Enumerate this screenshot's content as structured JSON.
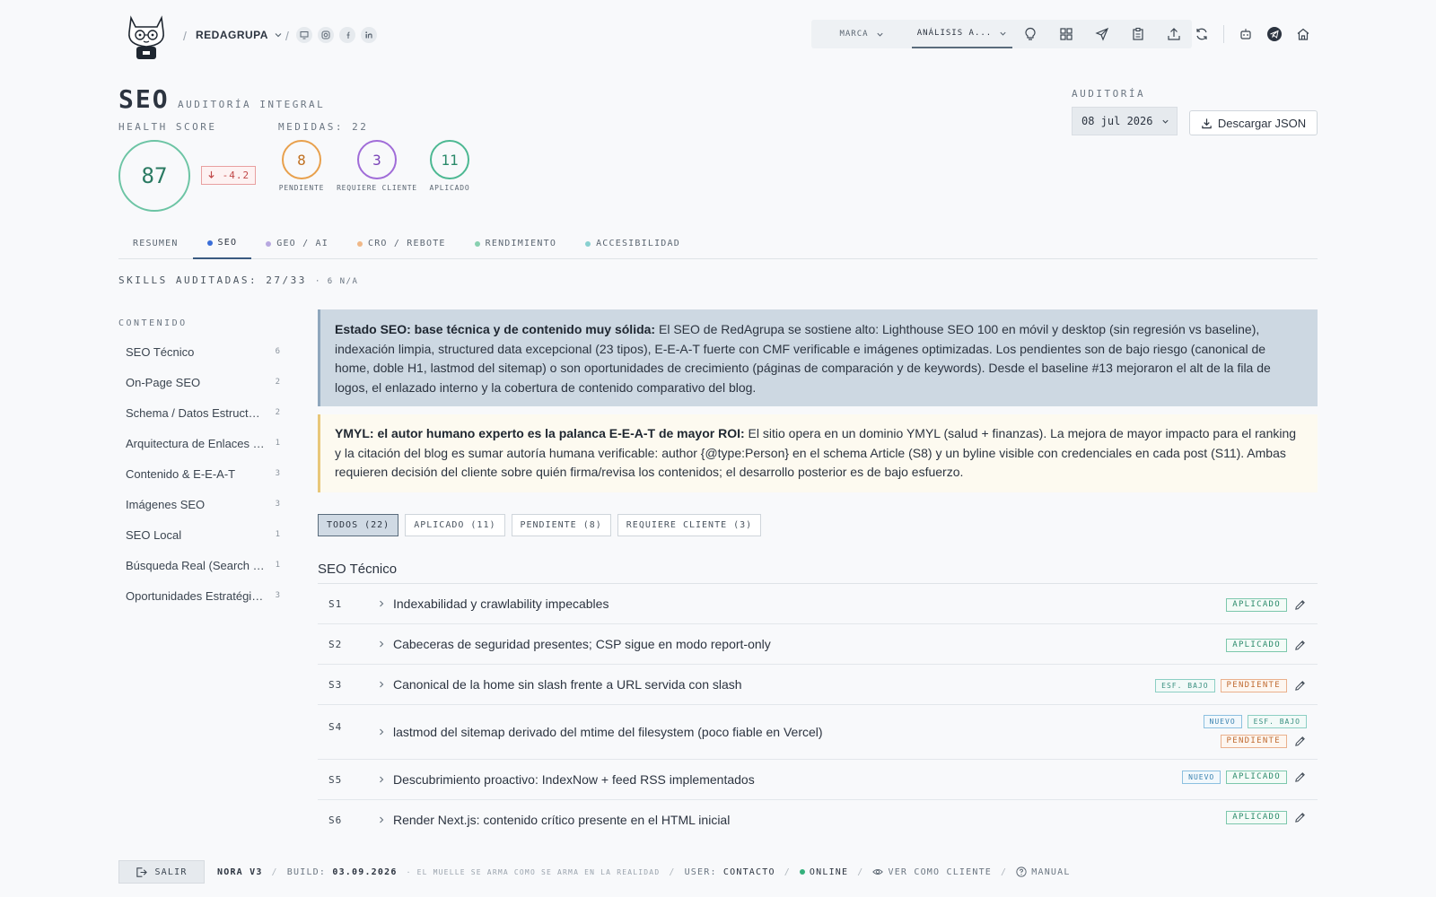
{
  "header": {
    "brand": "REDAGRUPA",
    "selects": [
      {
        "label": "MARCA"
      },
      {
        "label": "ANÁLISIS A..."
      }
    ]
  },
  "page": {
    "title": "SEO",
    "subtitle": "AUDITORÍA INTEGRAL",
    "health_label": "HEALTH SCORE",
    "health_score": "87",
    "health_delta": "-4.2",
    "measures_label": "MEDIDAS: 22",
    "measures": [
      {
        "value": "8",
        "label": "PENDIENTE",
        "color": "#e8a04c"
      },
      {
        "value": "3",
        "label": "REQUIERE CLIENTE",
        "color": "#a06cd8"
      },
      {
        "value": "11",
        "label": "APLICADO",
        "color": "#4cb892"
      }
    ],
    "audit_label": "AUDITORÍA",
    "audit_date": "08 jul 2026",
    "download_label": "Descargar JSON"
  },
  "tabs": [
    {
      "label": "RESUMEN",
      "dot": ""
    },
    {
      "label": "SEO",
      "dot": "#3a6ed8"
    },
    {
      "label": "GEO / AI",
      "dot": "#b8a8e0"
    },
    {
      "label": "CRO / REBOTE",
      "dot": "#f0b888"
    },
    {
      "label": "RENDIMIENTO",
      "dot": "#88d0b0"
    },
    {
      "label": "ACCESIBILIDAD",
      "dot": "#88d0d0"
    }
  ],
  "skills": {
    "text": "SKILLS AUDITADAS: 27/33",
    "na": "· 6 N/A"
  },
  "sidebar": {
    "heading": "CONTENIDO",
    "items": [
      {
        "label": "SEO Técnico",
        "count": "6"
      },
      {
        "label": "On-Page SEO",
        "count": "2"
      },
      {
        "label": "Schema / Datos Estructurados",
        "count": "2"
      },
      {
        "label": "Arquitectura de Enlaces Internos",
        "count": "1"
      },
      {
        "label": "Contenido & E-E-A-T",
        "count": "3"
      },
      {
        "label": "Imágenes SEO",
        "count": "3"
      },
      {
        "label": "SEO Local",
        "count": "1"
      },
      {
        "label": "Búsqueda Real (Search Console)",
        "count": "1"
      },
      {
        "label": "Oportunidades Estratégicas",
        "count": "3"
      }
    ]
  },
  "callouts": {
    "state_bold": "Estado SEO: base técnica y de contenido muy sólida:",
    "state_text": " El SEO de RedAgrupa se sostiene alto: Lighthouse SEO 100 en móvil y desktop (sin regresión vs baseline), indexación limpia, structured data excepcional (23 tipos), E-E-A-T fuerte con CMF verificable e imágenes optimizadas. Los pendientes son de bajo riesgo (canonical de home, doble H1, lastmod del sitemap) o son oportunidades de crecimiento (páginas de comparación y de keywords). Desde el baseline #13 mejoraron el alt de la fila de logos, el enlazado interno y la cobertura de contenido comparativo del blog.",
    "ymyl_bold": "YMYL: el autor humano experto es la palanca E-E-A-T de mayor ROI:",
    "ymyl_text": " El sitio opera en un dominio YMYL (salud + finanzas). La mejora de mayor impacto para el ranking y la citación del blog es sumar autoría humana verificable: author {@type:Person} en el schema Article (S8) y un byline visible con credenciales en cada post (S11). Ambas requieren decisión del cliente sobre quién firma/revisa los contenidos; el desarrollo posterior es de bajo esfuerzo."
  },
  "filters": [
    "TODOS (22)",
    "APLICADO (11)",
    "PENDIENTE (8)",
    "REQUIERE CLIENTE (3)"
  ],
  "section": {
    "title": "SEO Técnico",
    "rows": [
      {
        "id": "S1",
        "title": "Indexabilidad y crawlability impecables",
        "tags": [
          [
            "APLICADO",
            "ap"
          ]
        ]
      },
      {
        "id": "S2",
        "title": "Cabeceras de seguridad presentes; CSP sigue en modo report-only",
        "tags": [
          [
            "APLICADO",
            "ap"
          ]
        ]
      },
      {
        "id": "S3",
        "title": "Canonical de la home sin slash frente a URL servida con slash",
        "tags": [
          [
            "ESF. BAJO",
            "eb"
          ],
          [
            "PENDIENTE",
            "pe"
          ]
        ]
      },
      {
        "id": "S4",
        "title": "lastmod del sitemap derivado del mtime del filesystem (poco fiable en Vercel)",
        "tags": [
          [
            "NUEVO",
            "ne"
          ],
          [
            "ESF. BAJO",
            "eb"
          ],
          [
            "PENDIENTE",
            "pe"
          ]
        ]
      },
      {
        "id": "S5",
        "title": "Descubrimiento proactivo: IndexNow + feed RSS implementados",
        "tags": [
          [
            "NUEVO",
            "ne"
          ],
          [
            "APLICADO",
            "ap"
          ]
        ]
      },
      {
        "id": "S6",
        "title": "Render Next.js: contenido crítico presente en el HTML inicial",
        "tags": [
          [
            "APLICADO",
            "ap"
          ]
        ]
      }
    ]
  },
  "footer": {
    "exit": "SALIR",
    "version": "NORA V3",
    "build_label": "BUILD:",
    "build": "03.09.2026",
    "motto": "· EL MUELLE SE ARMA COMO SE ARMA EN LA REALIDAD",
    "user_label": "USER:",
    "user": "CONTACTO",
    "status": "ONLINE",
    "view_client": "VER COMO CLIENTE",
    "manual": "MANUAL"
  }
}
